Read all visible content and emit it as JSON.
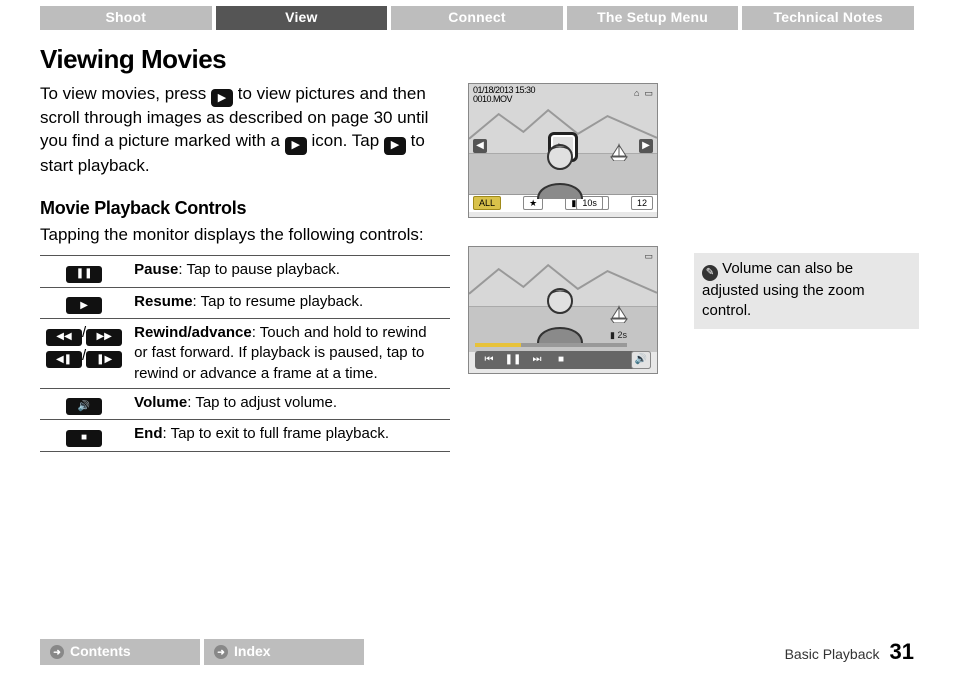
{
  "tabs": [
    "Shoot",
    "View",
    "Connect",
    "The Setup Menu",
    "Technical Notes"
  ],
  "active_tab": 1,
  "title": "Viewing Movies",
  "intro": {
    "p1a": "To view movies, press ",
    "p1b": " to view pictures and then scroll through images as described on page 30 until you find a picture marked with a ",
    "p1c": " icon. Tap ",
    "p1d": " to start playback."
  },
  "subhead": "Movie Playback Controls",
  "sub_intro": "Tapping the monitor displays the following controls:",
  "controls_table": [
    {
      "label": "Pause",
      "text": ": Tap to pause playback."
    },
    {
      "label": "Resume",
      "text": ": Tap to resume playback."
    },
    {
      "label": "Rewind/advance",
      "text": ": Touch and hold to rewind or fast forward. If playback is paused, tap to rewind or advance a frame at a time."
    },
    {
      "label": "Volume",
      "text": ": Tap to adjust volume."
    },
    {
      "label": "End",
      "text": ": Tap to exit to full frame playback."
    }
  ],
  "lcd1": {
    "date_line1": "01/18/2013  15:30",
    "date_line2": "0010.MOV",
    "bottom_left": "ALL",
    "bottom_mid": "★",
    "bottom_right": "12",
    "top_right": "10s",
    "top_icon": "⌂"
  },
  "lcd2": {
    "time": "2s",
    "buttons": [
      "⏮",
      "❚❚",
      "⏭",
      "■"
    ],
    "vol": "🔊"
  },
  "tip": {
    "text": " Volume can also be adjusted using the zoom control."
  },
  "footer": {
    "contents": "Contents",
    "index": "Index",
    "section": "Basic Playback",
    "page": "31"
  }
}
